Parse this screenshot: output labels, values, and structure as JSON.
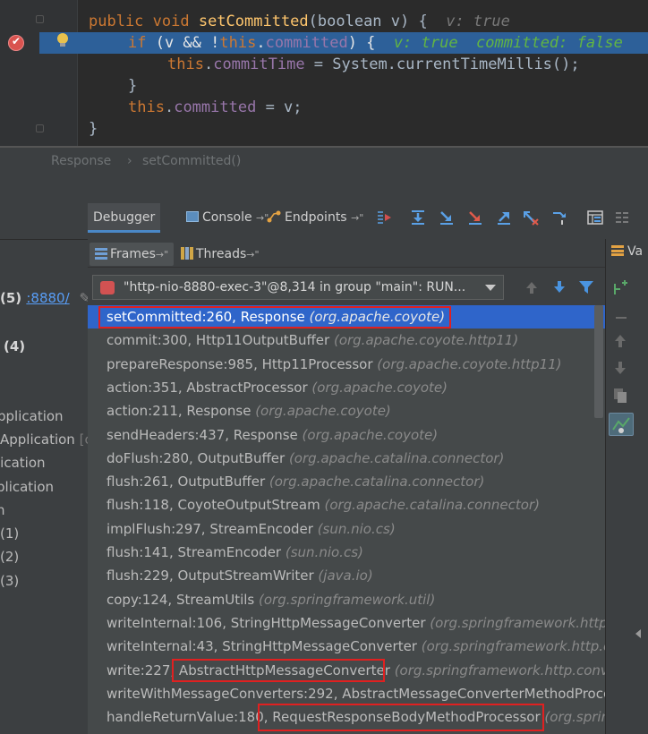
{
  "editor": {
    "lines": [
      {
        "kw": "public void ",
        "fn": "setCommitted",
        "rest": "(boolean v) {",
        "hint_name": "v: ",
        "hint_val": "true"
      },
      {
        "kw": "if",
        "rest": " (v && !",
        "kw2": "this",
        "rest2": ".",
        "fld": "committed",
        "rest3": ") {",
        "hint1": "v: true",
        "hint2": "committed: false"
      },
      {
        "kw": "this",
        "rest": ".",
        "fld": "commitTime",
        "rest2": " = System.",
        "rest3": "currentTimeMillis();"
      },
      {
        "text": "}"
      },
      {
        "kw": "this",
        "rest": ".",
        "fld": "committed",
        "rest2": " = v;"
      },
      {
        "text": "}"
      }
    ]
  },
  "breadcrumb": {
    "items": [
      "Response",
      "setCommitted()"
    ],
    "separator": "›"
  },
  "toolbar": {
    "tabs": [
      {
        "label": "Debugger"
      },
      {
        "label": "Console",
        "suffix": "→\""
      },
      {
        "label": "Endpoints",
        "suffix": "→\""
      }
    ]
  },
  "subtabs": [
    {
      "label": "Frames",
      "suffix": "→\""
    },
    {
      "label": "Threads",
      "suffix": "→\""
    }
  ],
  "right_panel": {
    "tab_label": "Va"
  },
  "thread": {
    "label": "\"http-nio-8880-exec-3\"@8,314 in group \"main\": RUN..."
  },
  "left_panel": {
    "rows": [
      {
        "prefix": "(5) ",
        "link": ":8880/"
      },
      {
        "text": "(4)"
      },
      {
        "text": "pplication"
      },
      {
        "text": "Application",
        "extra": "[c"
      },
      {
        "text": "lication"
      },
      {
        "text": "plication"
      },
      {
        "text": "n"
      },
      {
        "text": "(1)"
      },
      {
        "text": "(2)"
      },
      {
        "text": "(3)"
      }
    ]
  },
  "frames": [
    {
      "method": "setCommitted:260, Response ",
      "pkg": "(org.apache.coyote)"
    },
    {
      "method": "commit:300, Http11OutputBuffer ",
      "pkg": "(org.apache.coyote.http11)"
    },
    {
      "method": "prepareResponse:985, Http11Processor ",
      "pkg": "(org.apache.coyote.http11)"
    },
    {
      "method": "action:351, AbstractProcessor ",
      "pkg": "(org.apache.coyote)"
    },
    {
      "method": "action:211, Response ",
      "pkg": "(org.apache.coyote)"
    },
    {
      "method": "sendHeaders:437, Response ",
      "pkg": "(org.apache.coyote)"
    },
    {
      "method": "doFlush:280, OutputBuffer ",
      "pkg": "(org.apache.catalina.connector)"
    },
    {
      "method": "flush:261, OutputBuffer ",
      "pkg": "(org.apache.catalina.connector)"
    },
    {
      "method": "flush:118, CoyoteOutputStream ",
      "pkg": "(org.apache.catalina.connector)"
    },
    {
      "method": "implFlush:297, StreamEncoder ",
      "pkg": "(sun.nio.cs)"
    },
    {
      "method": "flush:141, StreamEncoder ",
      "pkg": "(sun.nio.cs)"
    },
    {
      "method": "flush:229, OutputStreamWriter ",
      "pkg": "(java.io)"
    },
    {
      "method": "copy:124, StreamUtils ",
      "pkg": "(org.springframework.util)"
    },
    {
      "method": "writeInternal:106, StringHttpMessageConverter ",
      "pkg": "(org.springframework.http.c"
    },
    {
      "method": "writeInternal:43, StringHttpMessageConverter ",
      "pkg": "(org.springframework.http.c"
    },
    {
      "method": "write:227, AbstractHttpMessageConverter ",
      "pkg": "(org.springframework.http.conve"
    },
    {
      "method": "writeWithMessageConverters:292, AbstractMessageConverterMethodProce",
      "pkg": ""
    },
    {
      "method": "handleReturnValue:180, RequestResponseBodyMethodProcessor ",
      "pkg": "(org.spring"
    }
  ],
  "colors": {
    "selection": "#2f65ca",
    "highlight_box": "#e02020",
    "exec_line": "#2d6099"
  }
}
